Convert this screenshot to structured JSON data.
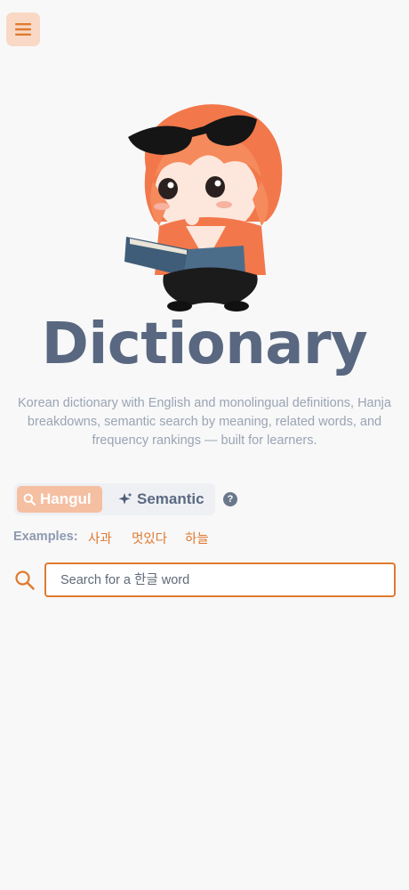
{
  "header": {
    "menu_icon": "hamburger-icon"
  },
  "hero": {
    "title": "Dictionary",
    "subtitle": "Korean dictionary with English and monolingual definitions, Hanja breakdowns, semantic search by meaning, related words, and frequency rankings — built for learners."
  },
  "search_modes": {
    "options": [
      {
        "label": "Hangul",
        "icon": "search-icon",
        "active": true
      },
      {
        "label": "Semantic",
        "icon": "sparkle-icon",
        "active": false
      }
    ],
    "help_symbol": "?"
  },
  "examples": {
    "label": "Examples:",
    "items": [
      "사과",
      "멋있다",
      "하늘"
    ]
  },
  "search": {
    "placeholder": "Search for a 한글 word",
    "value": ""
  },
  "colors": {
    "accent": "#e07a2e",
    "title": "#596880",
    "active_tab": "#f5bfa2",
    "menu_bg": "#f9d9c6"
  }
}
